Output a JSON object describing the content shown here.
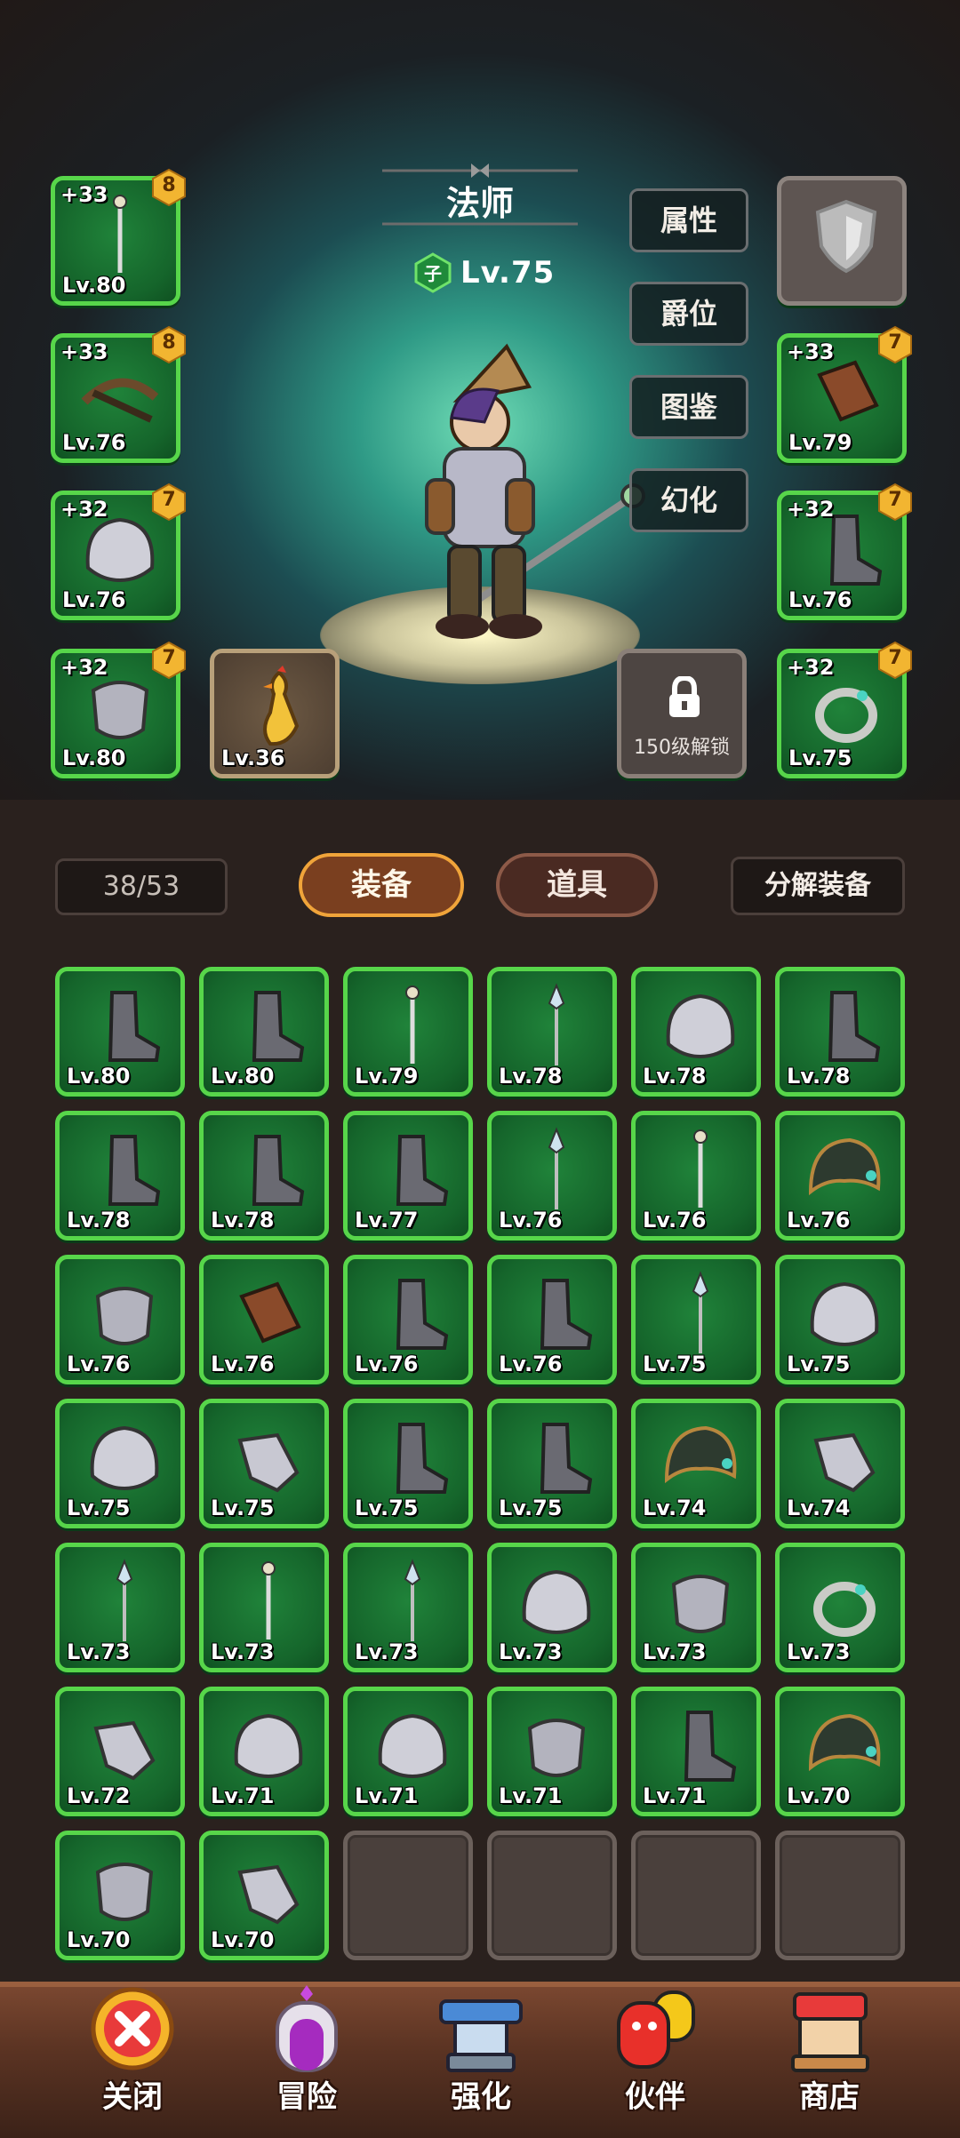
{
  "hero": {
    "class_name": "法师",
    "rank_badge": "子",
    "level": "Lv.75"
  },
  "side_buttons": [
    "属性",
    "爵位",
    "图鉴",
    "幻化"
  ],
  "equipped_left": [
    {
      "plus": "+33",
      "stars": "8",
      "level": "Lv.80",
      "icon": "staff-icon"
    },
    {
      "plus": "+33",
      "stars": "8",
      "level": "Lv.76",
      "icon": "crossbow-icon"
    },
    {
      "plus": "+32",
      "stars": "7",
      "level": "Lv.76",
      "icon": "helmet-icon"
    },
    {
      "plus": "+32",
      "stars": "7",
      "level": "Lv.80",
      "icon": "armor-icon"
    }
  ],
  "equipped_right": [
    {
      "plus": "",
      "stars": "",
      "level": "",
      "icon": "shield-icon"
    },
    {
      "plus": "+33",
      "stars": "7",
      "level": "Lv.79",
      "icon": "bracer-icon"
    },
    {
      "plus": "+32",
      "stars": "7",
      "level": "Lv.76",
      "icon": "boots-icon"
    },
    {
      "plus": "+32",
      "stars": "7",
      "level": "Lv.75",
      "icon": "ring-icon"
    }
  ],
  "special_slots": {
    "pet_level": "Lv.36",
    "locked_text": "150级解锁"
  },
  "toolbar": {
    "count": "38/53",
    "tab_equipment": "装备",
    "tab_items": "道具",
    "decompose": "分解装备"
  },
  "inventory": [
    {
      "level": "Lv.80",
      "icon": "boots-icon"
    },
    {
      "level": "Lv.80",
      "icon": "boots-icon"
    },
    {
      "level": "Lv.79",
      "icon": "staff-icon"
    },
    {
      "level": "Lv.78",
      "icon": "spear-icon"
    },
    {
      "level": "Lv.78",
      "icon": "helmet-icon"
    },
    {
      "level": "Lv.78",
      "icon": "boots-icon"
    },
    {
      "level": "Lv.78",
      "icon": "boots-icon"
    },
    {
      "level": "Lv.78",
      "icon": "boots-icon"
    },
    {
      "level": "Lv.77",
      "icon": "boots-icon"
    },
    {
      "level": "Lv.76",
      "icon": "spear-icon"
    },
    {
      "level": "Lv.76",
      "icon": "staff-icon"
    },
    {
      "level": "Lv.76",
      "icon": "hood-icon"
    },
    {
      "level": "Lv.76",
      "icon": "armor-icon"
    },
    {
      "level": "Lv.76",
      "icon": "bracer-icon"
    },
    {
      "level": "Lv.76",
      "icon": "boots-icon"
    },
    {
      "level": "Lv.76",
      "icon": "boots-icon"
    },
    {
      "level": "Lv.75",
      "icon": "spear-icon"
    },
    {
      "level": "Lv.75",
      "icon": "helmet-icon"
    },
    {
      "level": "Lv.75",
      "icon": "helmet-icon"
    },
    {
      "level": "Lv.75",
      "icon": "gauntlet-icon"
    },
    {
      "level": "Lv.75",
      "icon": "boots-icon"
    },
    {
      "level": "Lv.75",
      "icon": "boots-icon"
    },
    {
      "level": "Lv.74",
      "icon": "hood-icon"
    },
    {
      "level": "Lv.74",
      "icon": "gauntlet-icon"
    },
    {
      "level": "Lv.73",
      "icon": "spear-icon"
    },
    {
      "level": "Lv.73",
      "icon": "staff-icon"
    },
    {
      "level": "Lv.73",
      "icon": "spear-icon"
    },
    {
      "level": "Lv.73",
      "icon": "helmet-icon"
    },
    {
      "level": "Lv.73",
      "icon": "armor-icon"
    },
    {
      "level": "Lv.73",
      "icon": "ring-icon"
    },
    {
      "level": "Lv.72",
      "icon": "gauntlet-icon"
    },
    {
      "level": "Lv.71",
      "icon": "helmet-icon"
    },
    {
      "level": "Lv.71",
      "icon": "helmet-icon"
    },
    {
      "level": "Lv.71",
      "icon": "armor-icon"
    },
    {
      "level": "Lv.71",
      "icon": "boots-icon"
    },
    {
      "level": "Lv.70",
      "icon": "hood-icon"
    },
    {
      "level": "Lv.70",
      "icon": "armor-icon"
    },
    {
      "level": "Lv.70",
      "icon": "gauntlet-icon"
    },
    {
      "level": "",
      "icon": ""
    },
    {
      "level": "",
      "icon": ""
    },
    {
      "level": "",
      "icon": ""
    },
    {
      "level": "",
      "icon": ""
    }
  ],
  "bottom_nav": [
    {
      "label": "关闭",
      "icon": "close-icon"
    },
    {
      "label": "冒险",
      "icon": "portal-icon"
    },
    {
      "label": "强化",
      "icon": "anvil-icon"
    },
    {
      "label": "伙伴",
      "icon": "companion-icon"
    },
    {
      "label": "商店",
      "icon": "shop-icon"
    }
  ],
  "colors": {
    "slot_border": "#57d64a",
    "slot_fill": "#15652b",
    "tab_active_border": "#f0a43a",
    "badge": "#f2b531",
    "background": "#2a211e"
  }
}
